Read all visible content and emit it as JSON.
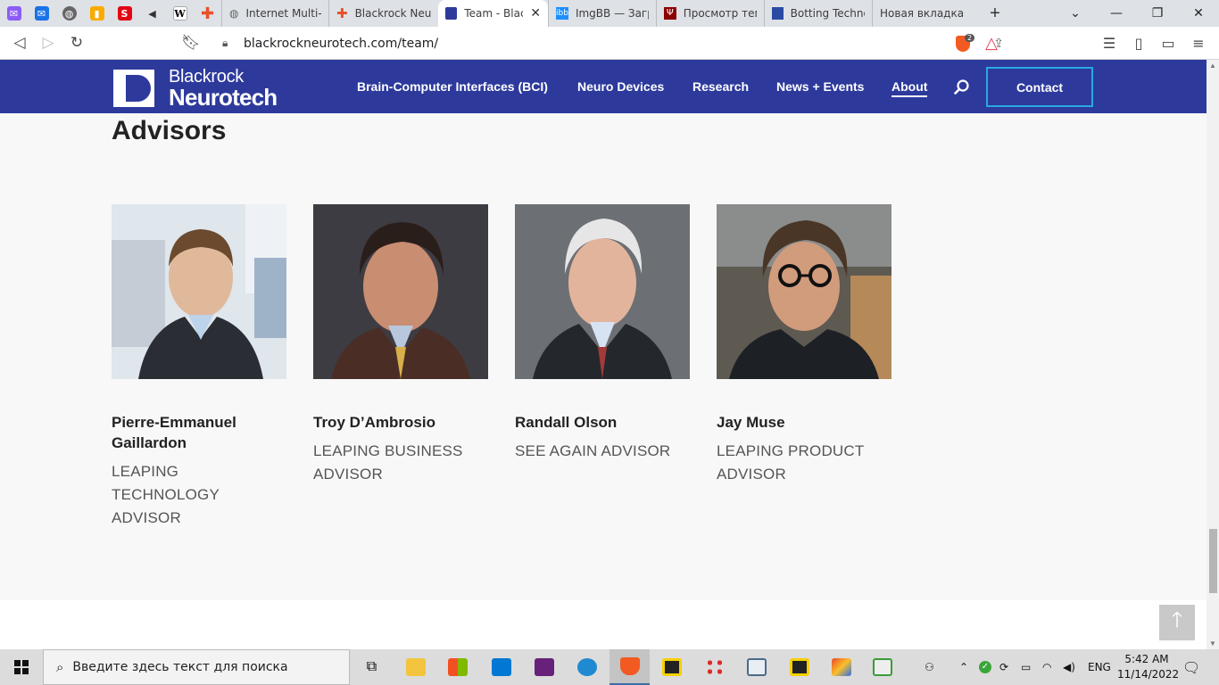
{
  "browser": {
    "tabs": [
      {
        "title": "Internet Multi-S"
      },
      {
        "title": "Blackrock Neuro"
      },
      {
        "title": "Team - Blac"
      },
      {
        "title": "ImgBB — Загру"
      },
      {
        "title": "Просмотр тема"
      },
      {
        "title": "Botting Technol"
      },
      {
        "title": "Новая вкладка"
      }
    ],
    "new_tab_label": "+",
    "url": "blackrockneurotech.com/team/",
    "shield_count": "2"
  },
  "site": {
    "logo_line1": "Blackrock",
    "logo_line2": "Neurotech",
    "nav": [
      {
        "label": "Brain-Computer Interfaces (BCI)"
      },
      {
        "label": "Neuro Devices"
      },
      {
        "label": "Research"
      },
      {
        "label": "News + Events"
      },
      {
        "label": "About"
      }
    ],
    "contact_label": "Contact",
    "brand_color": "#2d3a9c",
    "accent_color": "#29a9e0"
  },
  "main": {
    "heading": "Advisors",
    "advisors": [
      {
        "name": "Pierre-Emmanuel Gaillardon",
        "role": "LEAPING TECHNOLOGY ADVISOR"
      },
      {
        "name": "Troy D’Ambrosio",
        "role": "LEAPING BUSINESS ADVISOR"
      },
      {
        "name": "Randall Olson",
        "role": "SEE AGAIN ADVISOR"
      },
      {
        "name": "Jay Muse",
        "role": "LEAPING PRODUCT ADVISOR"
      }
    ]
  },
  "taskbar": {
    "search_placeholder": "Введите здесь текст для поиска",
    "language": "ENG",
    "time": "5:42 AM",
    "date": "11/14/2022"
  }
}
